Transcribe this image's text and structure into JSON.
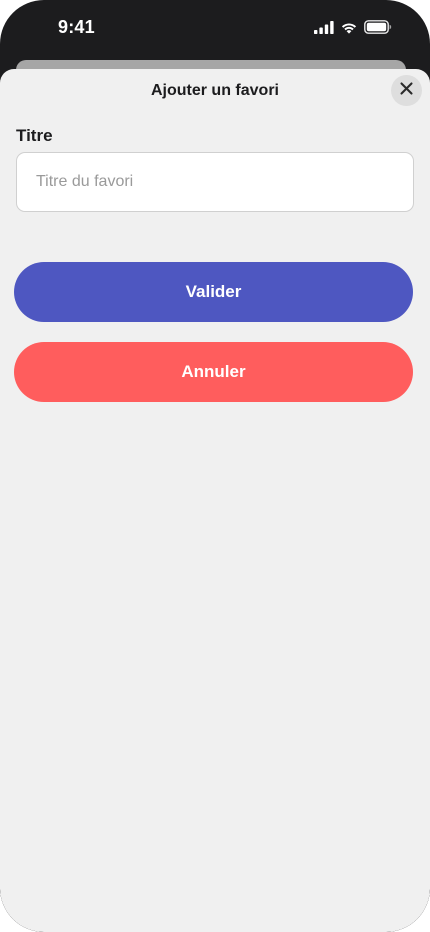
{
  "status_bar": {
    "time": "9:41",
    "icons": [
      "cellular-signal-icon",
      "wifi-icon",
      "battery-icon"
    ]
  },
  "sheet": {
    "title": "Ajouter un favori",
    "close_icon": "close-icon"
  },
  "form": {
    "title_label": "Titre",
    "title_value": "",
    "title_placeholder": "Titre du favori"
  },
  "actions": {
    "validate_label": "Valider",
    "cancel_label": "Annuler"
  },
  "colors": {
    "validate": "#4e57c1",
    "cancel": "#ff5d5d",
    "sheet_background": "#f0f0f0",
    "status_bar_background": "#1c1c1e"
  }
}
